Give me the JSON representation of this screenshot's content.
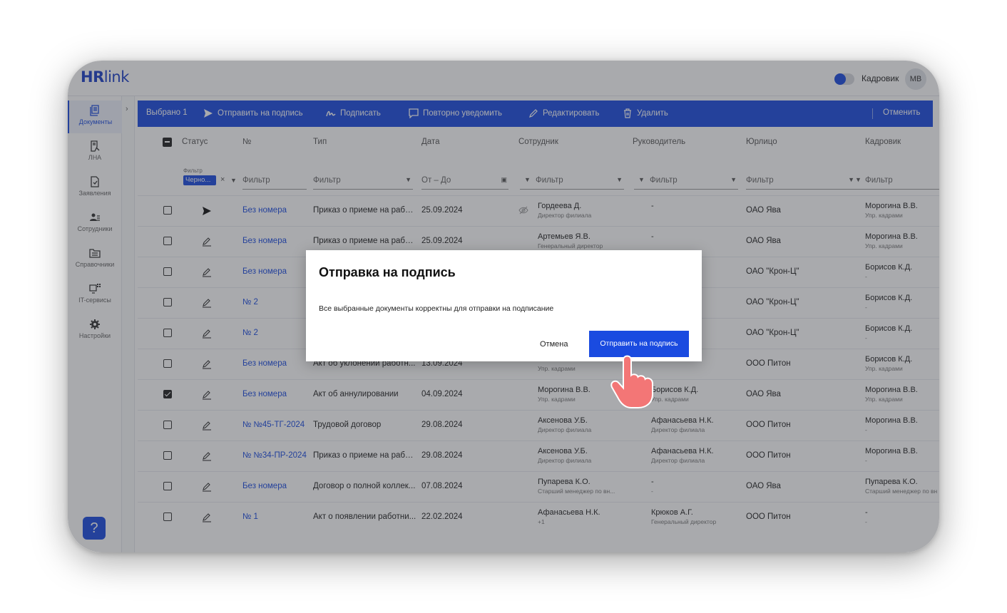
{
  "header": {
    "logo_main": "HR",
    "logo_sub": "link",
    "role_label": "Кадровик",
    "avatar_initials": "МВ"
  },
  "sidebar": {
    "items": [
      {
        "label": "Документы",
        "icon": "documents-icon",
        "active": true
      },
      {
        "label": "ЛНА",
        "icon": "lna-icon"
      },
      {
        "label": "Заявления",
        "icon": "applications-icon"
      },
      {
        "label": "Сотрудники",
        "icon": "employees-icon"
      },
      {
        "label": "Справочники",
        "icon": "directories-icon"
      },
      {
        "label": "IT-сервисы",
        "icon": "it-services-icon"
      },
      {
        "label": "Настройки",
        "icon": "settings-icon"
      }
    ],
    "help_label": "?"
  },
  "actionbar": {
    "selected": "Выбрано 1",
    "send": "Отправить на подпись",
    "sign": "Подписать",
    "notify": "Повторно уведомить",
    "edit": "Редактировать",
    "delete": "Удалить",
    "cancel": "Отменить"
  },
  "table": {
    "headers": {
      "status": "Статус",
      "number": "№",
      "type": "Тип",
      "date": "Дата",
      "employee": "Сотрудник",
      "manager": "Руководитель",
      "org": "Юрлицо",
      "hr": "Кадровик"
    },
    "filters": {
      "chip_label": "Фильтр",
      "chip_value": "Черно...",
      "chip_clear": "×",
      "number": "Фильтр",
      "type": "Фильтр",
      "date": "От – До",
      "employee": "Фильтр",
      "manager": "Фильтр",
      "org": "Фильтр",
      "hr": "Фильтр"
    },
    "rows": [
      {
        "status": "sent",
        "number": "Без номера",
        "type": "Приказ о приеме на работу",
        "date": "25.09.2024",
        "emp_name": "Гордеева Д.",
        "emp_pos": "Директор филиала",
        "mgr_name": "-",
        "mgr_pos": "",
        "org": "ОАО Ява",
        "hr_name": "Морогина В.В.",
        "hr_pos": "Упр. кадрами",
        "hidden": true
      },
      {
        "status": "draft",
        "number": "Без номера",
        "type": "Приказ о приеме на работу",
        "date": "25.09.2024",
        "emp_name": "Артемьев Я.В.",
        "emp_pos": "Генеральный директор",
        "mgr_name": "-",
        "mgr_pos": "",
        "org": "ОАО Ява",
        "hr_name": "Морогина В.В.",
        "hr_pos": "Упр. кадрами"
      },
      {
        "status": "draft",
        "number": "Без номера",
        "type": "",
        "date": "",
        "emp_name": "",
        "emp_pos": "",
        "mgr_name": "",
        "mgr_pos": "",
        "org": "ОАО \"Крон-Ц\"",
        "hr_name": "Борисов К.Д.",
        "hr_pos": "-"
      },
      {
        "status": "draft",
        "number": "№ 2",
        "type": "",
        "date": "",
        "emp_name": "",
        "emp_pos": "",
        "mgr_name": "",
        "mgr_pos": "",
        "org": "ОАО \"Крон-Ц\"",
        "hr_name": "Борисов К.Д.",
        "hr_pos": "-"
      },
      {
        "status": "draft",
        "number": "№ 2",
        "type": "",
        "date": "",
        "emp_name": "",
        "emp_pos": "",
        "mgr_name": "",
        "mgr_pos": "",
        "org": "ОАО \"Крон-Ц\"",
        "hr_name": "Борисов К.Д.",
        "hr_pos": "-"
      },
      {
        "status": "draft",
        "number": "Без номера",
        "type": "Акт об уклонении работн...",
        "date": "13.09.2024",
        "emp_name": "",
        "emp_pos": "Упр. кадрами",
        "mgr_name": "",
        "mgr_pos": "",
        "org": "ООО Питон",
        "hr_name": "Борисов К.Д.",
        "hr_pos": "Упр. кадрами"
      },
      {
        "status": "draft",
        "checked": true,
        "number": "Без номера",
        "type": "Акт об аннулировании",
        "date": "04.09.2024",
        "emp_name": "Морогина В.В.",
        "emp_pos": "Упр. кадрами",
        "mgr_name": "Борисов К.Д.",
        "mgr_pos": "Упр. кадрами",
        "org": "ОАО Ява",
        "hr_name": "Морогина В.В.",
        "hr_pos": "Упр. кадрами"
      },
      {
        "status": "draft",
        "number": "№ №45-ТГ-2024",
        "type": "Трудовой договор",
        "date": "29.08.2024",
        "emp_name": "Аксенова У.Б.",
        "emp_pos": "Директор филиала",
        "mgr_name": "Афанасьева Н.К.",
        "mgr_pos": "Директор филиала",
        "org": "ООО Питон",
        "hr_name": "Морогина В.В.",
        "hr_pos": "-"
      },
      {
        "status": "draft",
        "number": "№ №34-ПР-2024",
        "type": "Приказ о приеме на работу",
        "date": "29.08.2024",
        "emp_name": "Аксенова У.Б.",
        "emp_pos": "Директор филиала",
        "mgr_name": "Афанасьева Н.К.",
        "mgr_pos": "Директор филиала",
        "org": "ООО Питон",
        "hr_name": "Морогина В.В.",
        "hr_pos": "-"
      },
      {
        "status": "draft",
        "number": "Без номера",
        "type": "Договор о полной коллек...",
        "date": "07.08.2024",
        "emp_name": "Пупарева К.О.",
        "emp_pos": "Старший менеджер по вн...",
        "mgr_name": "-",
        "mgr_pos": "-",
        "org": "ОАО Ява",
        "hr_name": "Пупарева К.О.",
        "hr_pos": "Старший менеджер по вн"
      },
      {
        "status": "draft",
        "number": "№ 1",
        "type": "Акт о появлении работни...",
        "date": "22.02.2024",
        "emp_name": "Афанасьева Н.К.",
        "emp_pos": "+1",
        "mgr_name": "Крюков А.Г.",
        "mgr_pos": "Генеральный директор",
        "org": "ООО Питон",
        "hr_name": "-",
        "hr_pos": "-"
      }
    ]
  },
  "modal": {
    "title": "Отправка на подпись",
    "message": "Все выбранные документы корректны для отправки на подписание",
    "cancel": "Отмена",
    "confirm": "Отправить на подпись"
  },
  "colors": {
    "accent": "#1a4be0",
    "overlay": "rgba(50,52,60,0.42)"
  }
}
